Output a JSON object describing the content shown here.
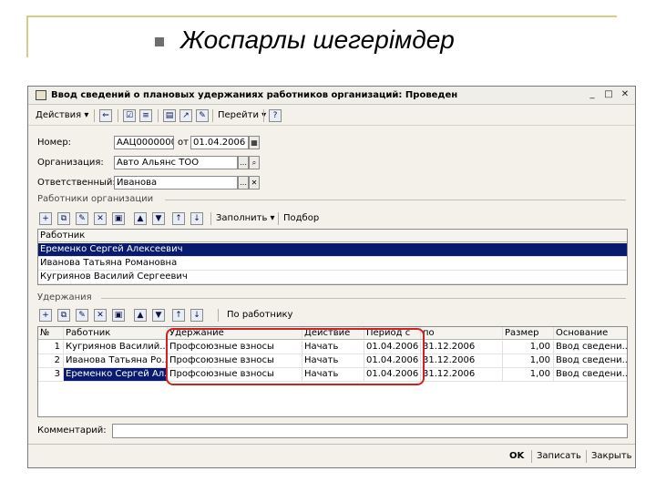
{
  "slide": {
    "title": "Жоспарлы шегерімдер"
  },
  "window": {
    "title": "Ввод сведений о плановых удержаниях работников организаций: Проведен",
    "controls": {
      "minimize": "_",
      "maximize": "□",
      "close": "✕"
    }
  },
  "toolbar": {
    "actions": "Действия ▾",
    "goto": "Перейти ▾",
    "help": "?"
  },
  "header": {
    "number_label": "Номер:",
    "number_value": "ААЦ0000000",
    "from_label": "от",
    "date_value": "01.04.2006 1",
    "org_label": "Организация:",
    "org_value": "Авто Альянс ТОО",
    "resp_label": "Ответственный:",
    "resp_value": "Иванова"
  },
  "employees_section": {
    "title": "Работники организации",
    "fill_button": "Заполнить ▾",
    "select_button": "Подбор",
    "column": "Работник",
    "rows": [
      "Еременко Сергей Алексеевич",
      "Иванова Татьяна Романовна",
      "Кугриянов Василий Сергеевич"
    ]
  },
  "deductions_section": {
    "title": "Удержания",
    "by_employee_button": "По работнику",
    "columns": [
      "№",
      "Работник",
      "Удержание",
      "Действие",
      "Период с",
      "по",
      "Размер",
      "Основание"
    ],
    "rows": [
      {
        "n": "1",
        "employee": "Кугриянов Василий...",
        "deduction": "Профсоюзные взносы",
        "action": "Начать",
        "from": "01.04.2006",
        "to": "31.12.2006",
        "amount": "1,00",
        "basis": "Ввод сведени..."
      },
      {
        "n": "2",
        "employee": "Иванова Татьяна Ро...",
        "deduction": "Профсоюзные взносы",
        "action": "Начать",
        "from": "01.04.2006",
        "to": "31.12.2006",
        "amount": "1,00",
        "basis": "Ввод сведени..."
      },
      {
        "n": "3",
        "employee": "Еременко Сергей Ал...",
        "deduction": "Профсоюзные взносы",
        "action": "Начать",
        "from": "01.04.2006",
        "to": "31.12.2006",
        "amount": "1,00",
        "basis": "Ввод сведени..."
      }
    ]
  },
  "footer": {
    "comment_label": "Комментарий:",
    "ok": "OK",
    "save": "Записать",
    "close": "Закрыть"
  },
  "colors": {
    "selection": "#0a1a6e",
    "highlight": "#d42020",
    "slide_rule": "#d8cc8a"
  }
}
